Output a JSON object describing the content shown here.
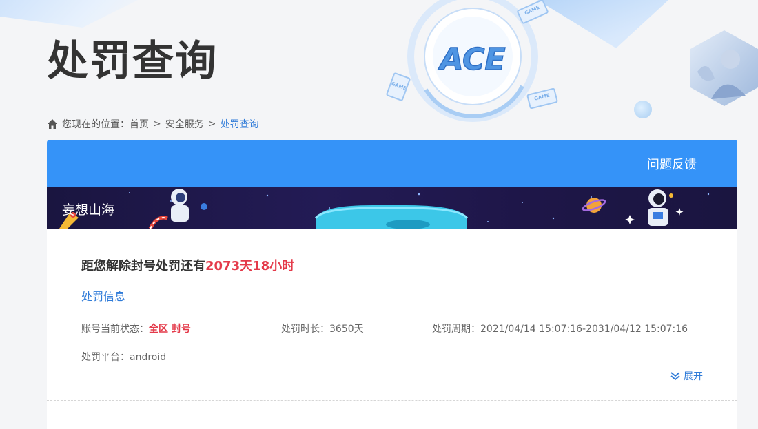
{
  "page": {
    "title": "处罚查询"
  },
  "hero": {
    "logo_text": "ACE",
    "chip_label": "GAME"
  },
  "breadcrumb": {
    "prefix": "您现在的位置：",
    "items": [
      "首页",
      "安全服务"
    ],
    "current": "处罚查询",
    "separator": ">"
  },
  "card": {
    "feedback_label": "问题反馈",
    "game_name": "妄想山海"
  },
  "penalty": {
    "countdown_prefix": "距您解除封号处罚还有",
    "countdown_value": "2073天18小时",
    "section_label": "处罚信息",
    "status_label": "账号当前状态：",
    "status_value": "全区 封号",
    "duration_label": "处罚时长：",
    "duration_value": "3650天",
    "period_label": "处罚周期：",
    "period_value": "2021/04/14 15:07:16-2031/04/12 15:07:16",
    "platform_label": "处罚平台：",
    "platform_value": "android",
    "expand_label": "展开"
  },
  "colors": {
    "accent": "#3593f8",
    "link": "#2f7bd8",
    "danger": "#e43a4a",
    "banner_bg": "#1a1540"
  }
}
